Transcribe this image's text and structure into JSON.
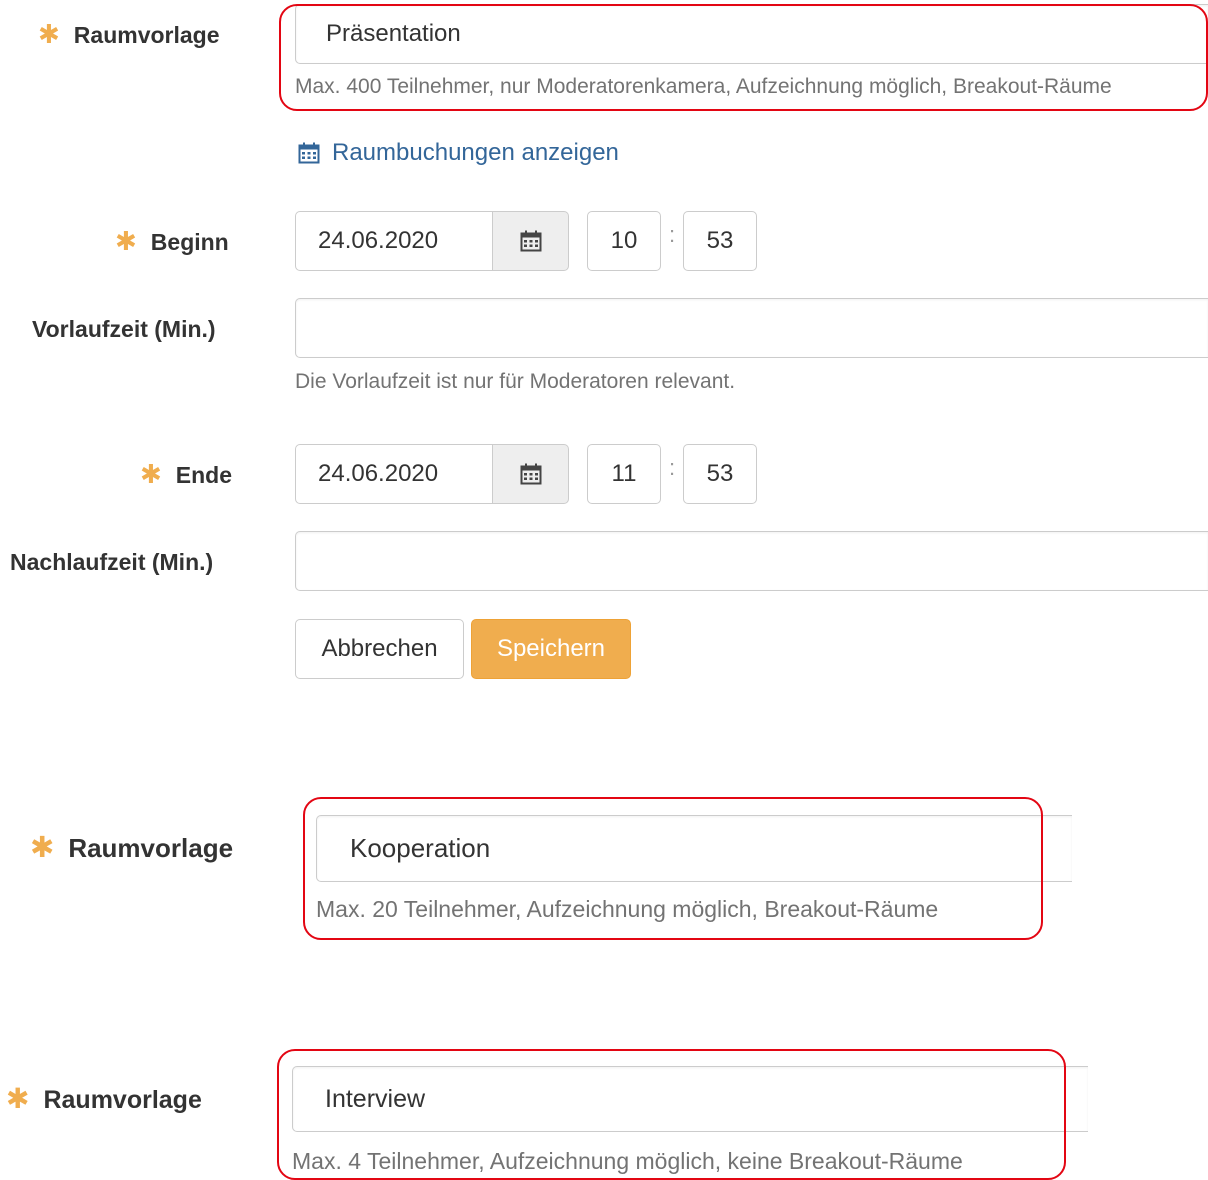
{
  "form": {
    "room_template": {
      "label": "Raumvorlage",
      "value": "Präsentation",
      "help": "Max. 400 Teilnehmer, nur Moderatorenkamera, Aufzeichnung möglich, Breakout-Räume"
    },
    "bookings_link": "Raumbuchungen anzeigen",
    "start": {
      "label": "Beginn",
      "date": "24.06.2020",
      "hour": "10",
      "minute": "53"
    },
    "lead_time": {
      "label": "Vorlaufzeit (Min.)",
      "value": "",
      "help": "Die Vorlaufzeit ist nur für Moderatoren relevant."
    },
    "end": {
      "label": "Ende",
      "date": "24.06.2020",
      "hour": "11",
      "minute": "53"
    },
    "follow_time": {
      "label": "Nachlaufzeit (Min.)",
      "value": ""
    },
    "cancel_label": "Abbrechen",
    "save_label": "Speichern"
  },
  "template_kooperation": {
    "label": "Raumvorlage",
    "value": "Kooperation",
    "help": "Max. 20 Teilnehmer, Aufzeichnung möglich, Breakout-Räume"
  },
  "template_interview": {
    "label": "Raumvorlage",
    "value": "Interview",
    "help": "Max. 4 Teilnehmer, Aufzeichnung möglich, keine Breakout-Räume"
  },
  "colors": {
    "accent": "#f0ad4e",
    "highlight": "#e30613",
    "link": "#336699"
  },
  "icons": {
    "required": "asterisk-icon",
    "calendar": "calendar-icon"
  }
}
